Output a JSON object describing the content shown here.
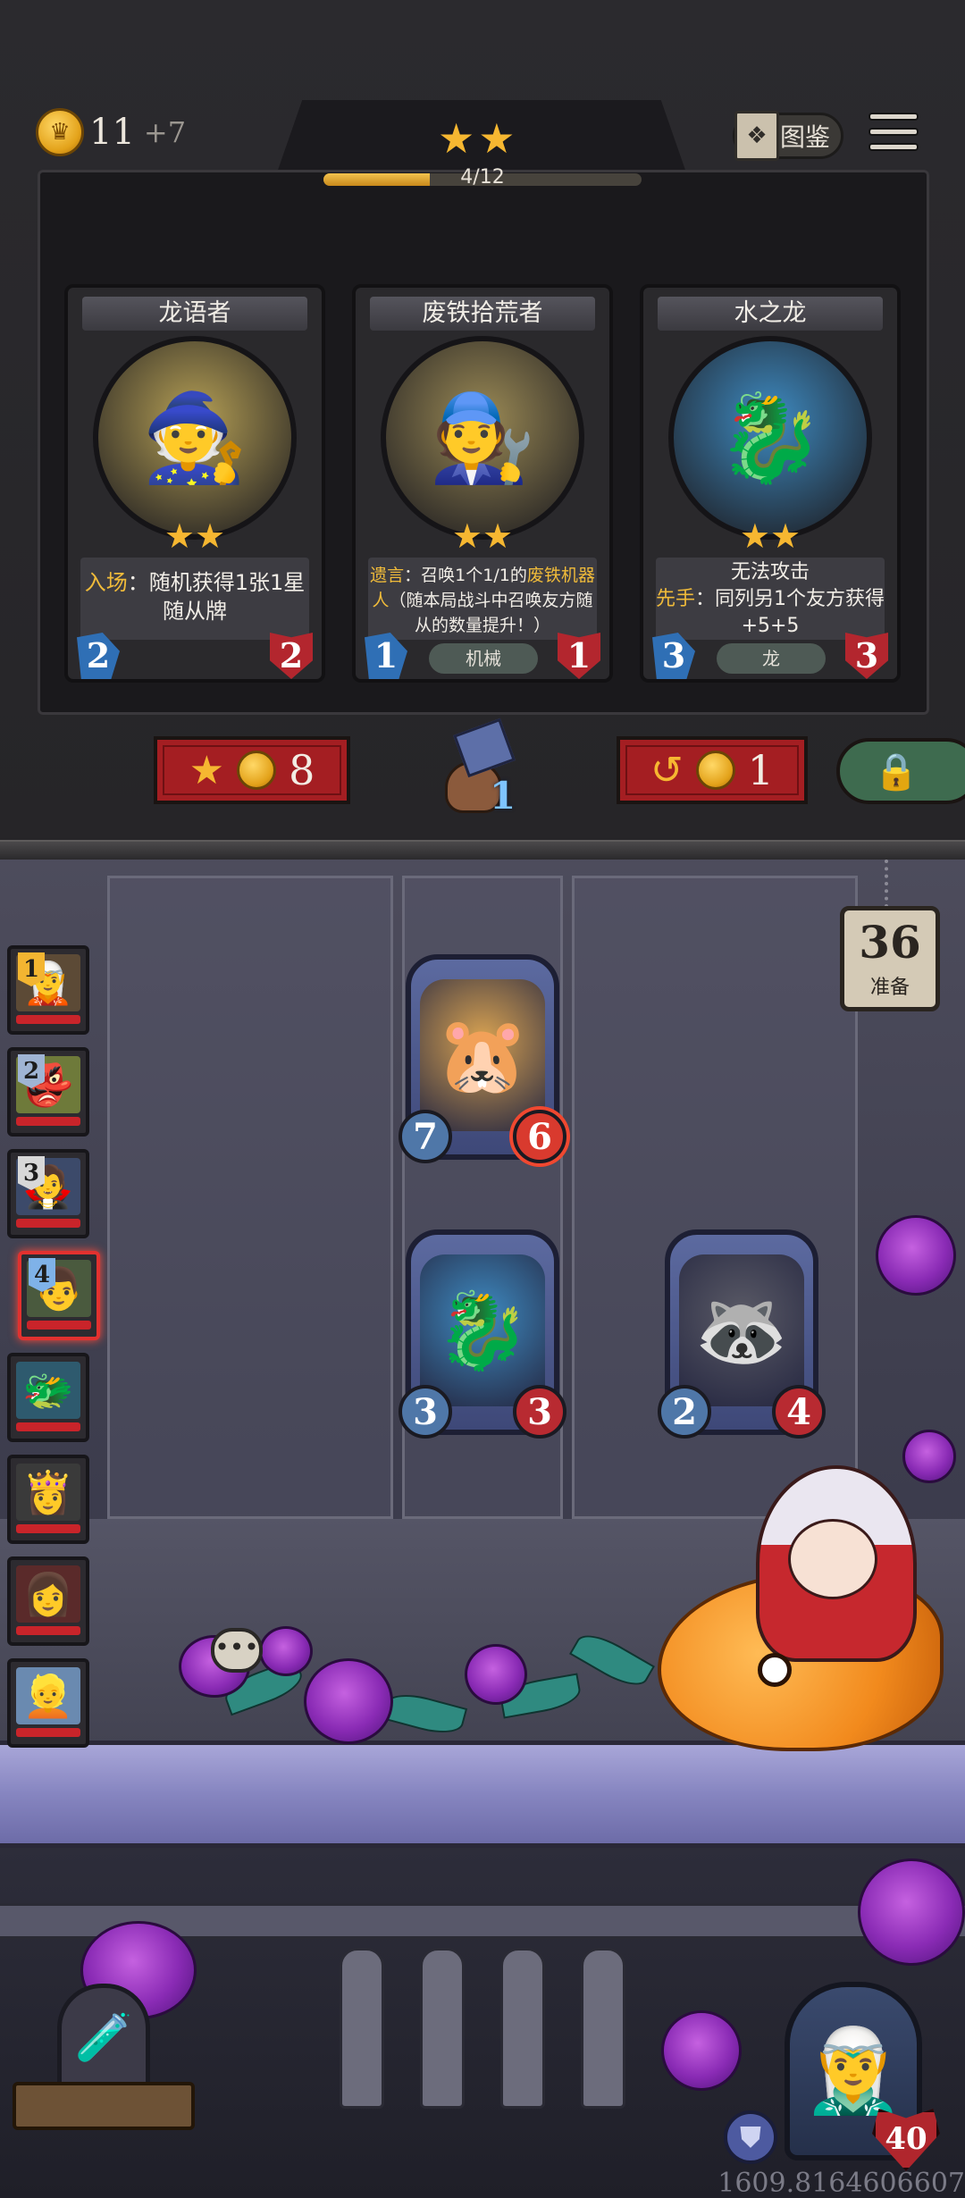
{
  "header": {
    "gold": "11",
    "gold_income": "+7",
    "tavern_tier_stars": "★★",
    "tier_progress_text": "4/12",
    "tier_progress_fraction": 0.333,
    "codex_label": "图鉴"
  },
  "shop": {
    "cards": [
      {
        "name": "龙语者",
        "stars": "★★",
        "desc_keyword": "入场",
        "desc_text": "：随机获得1张1星随从牌",
        "tribe": "",
        "attack": "2",
        "health": "2",
        "portrait_icon": "🧙",
        "portrait_color": "#b6a055"
      },
      {
        "name": "废铁拾荒者",
        "stars": "★★",
        "desc_keyword": "遗言",
        "desc_text_1": "：召唤1个1/1的",
        "desc_keyword_2": "废铁机器人",
        "desc_text_2": "（随本局战斗中召唤友方随从的数量提升！）",
        "tribe": "机械",
        "attack": "1",
        "health": "1",
        "portrait_icon": "🧑‍🔧",
        "portrait_color": "#9b8a55"
      },
      {
        "name": "水之龙",
        "stars": "★★",
        "desc_line_1": "无法攻击",
        "desc_keyword": "先手",
        "desc_text": "：同列另1个友方获得+5+5",
        "tribe": "龙",
        "attack": "3",
        "health": "3",
        "portrait_icon": "🐉",
        "portrait_color": "#3e8bc2"
      }
    ],
    "upgrade_cost": "8",
    "sell_value": "1",
    "refresh_cost": "1",
    "lock_icon": "lock-icon"
  },
  "timer": {
    "seconds": "36",
    "label": "准备"
  },
  "players": [
    {
      "rank": "1",
      "icon": "🧝",
      "rank_color": "#f3b531",
      "face_color": "#5c4a36"
    },
    {
      "rank": "2",
      "icon": "👺",
      "rank_color": "#9fb4d4",
      "face_color": "#6e7a3a"
    },
    {
      "rank": "3",
      "icon": "🧛",
      "rank_color": "#d8d8d8",
      "face_color": "#3c4a6a"
    },
    {
      "rank": "4",
      "icon": "👨",
      "rank_color": "#7fb2e8",
      "face_color": "#4a5a3e"
    },
    {
      "rank": "",
      "icon": "🐲",
      "rank_color": "",
      "face_color": "#2e5a6e"
    },
    {
      "rank": "",
      "icon": "👸",
      "rank_color": "",
      "face_color": "#3a3a3a"
    },
    {
      "rank": "",
      "icon": "👩",
      "rank_color": "",
      "face_color": "#5a2a2a"
    },
    {
      "rank": "",
      "icon": "👱",
      "rank_color": "",
      "face_color": "#6a8ab0"
    }
  ],
  "board": {
    "minions": [
      {
        "icon": "🐹",
        "attack": "7",
        "health": "6",
        "art_color": "#d9a352",
        "buffed": true
      },
      {
        "icon": "🐉",
        "attack": "3",
        "health": "3",
        "art_color": "#3e8bc2",
        "buffed": false
      },
      {
        "icon": "🦝",
        "attack": "2",
        "health": "4",
        "art_color": "#5a5a66",
        "buffed": false
      }
    ]
  },
  "hero": {
    "health": "40",
    "icon": "🧝‍♂️"
  },
  "tavern_icon": "🧪",
  "chat_icon": "💬",
  "coordinates": "1609.8164606607"
}
